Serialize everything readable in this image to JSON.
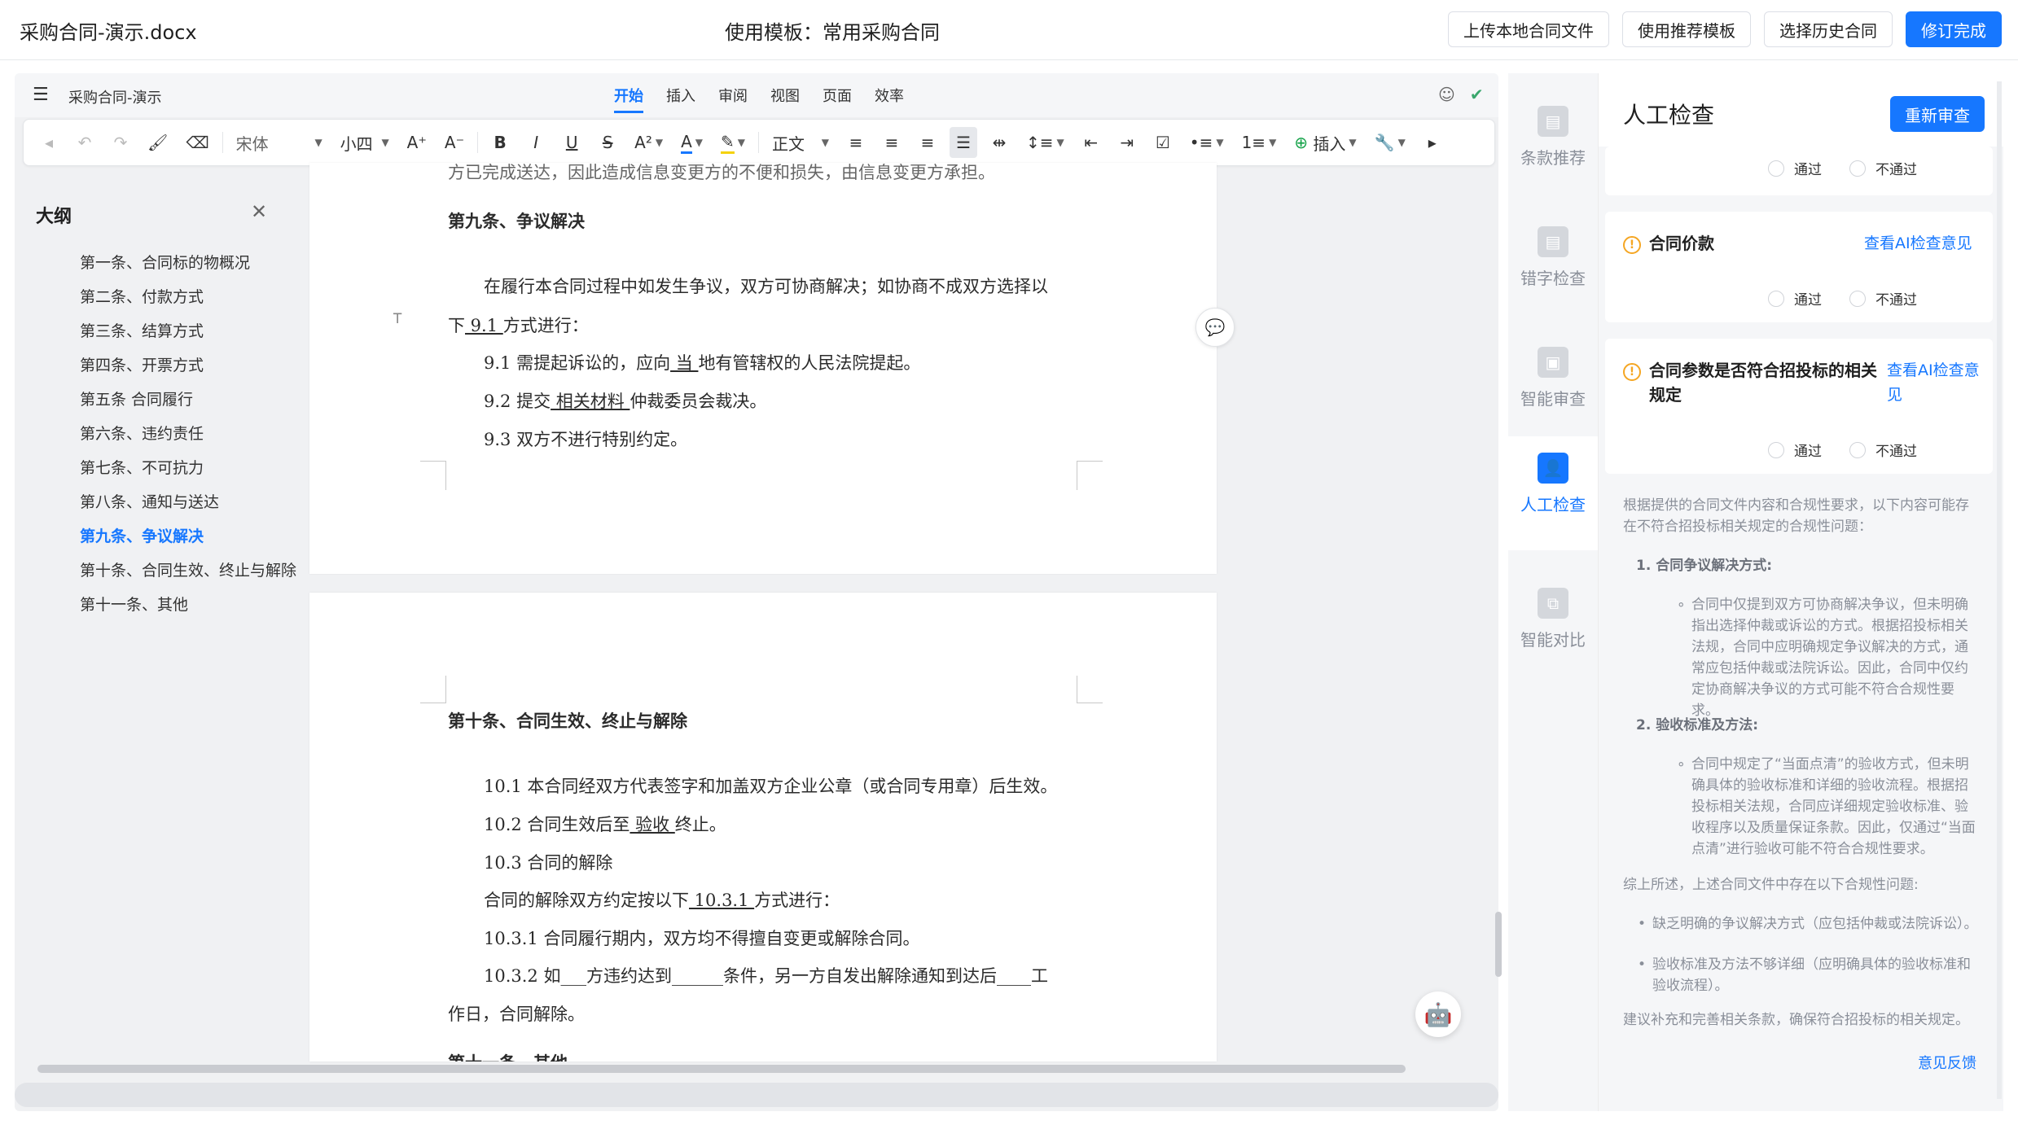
{
  "topbar": {
    "doc_title": "采购合同-演示.docx",
    "template": "使用模板：常用采购合同",
    "buttons": [
      "上传本地合同文件",
      "使用推荐模板",
      "选择历史合同",
      "修订完成"
    ]
  },
  "editor": {
    "doc_name": "采购合同-演示",
    "tabs": [
      "开始",
      "插入",
      "审阅",
      "视图",
      "页面",
      "效率"
    ],
    "active_tab": "开始",
    "toolbar": {
      "font": "宋体",
      "size": "小四",
      "para_style": "正文",
      "insert_label": "插入"
    }
  },
  "outline": {
    "title": "大纲",
    "items": [
      "第一条、合同标的物概况",
      "第二条、付款方式",
      "第三条、结算方式",
      "第四条、开票方式",
      "第五条 合同履行",
      "第六条、违约责任",
      "第七条、不可抗力",
      "第八条、通知与送达",
      "第九条、争议解决",
      "第十条、合同生效、终止与解除",
      "第十一条、其他"
    ],
    "active_index": 8
  },
  "page1": {
    "top_fragment": "方已完成送达，因此造成信息变更方的不便和损失，由信息变更方承担。",
    "heading": "第九条、争议解决",
    "p1a": "在履行本合同过程中如发生争议，双方可协商解决；如协商不成双方选择以",
    "p1b_pre": "下",
    "p1b_fill": " 9.1 ",
    "p1b_post": "方式进行：",
    "l1_pre": "9.1 需提起诉讼的，应向",
    "l1_fill": " 当 ",
    "l1_post": "地有管辖权的人民法院提起。",
    "l2_pre": "9.2 提交",
    "l2_fill": " 相关材料 ",
    "l2_post": "仲裁委员会裁决。",
    "l3": "9.3 双方不进行特别约定。"
  },
  "page2": {
    "heading": "第十条、合同生效、终止与解除",
    "l1": "10.1 本合同经双方代表签字和加盖双方企业公章（或合同专用章）后生效。",
    "l2_pre": "10.2 合同生效后至",
    "l2_fill": " 验收 ",
    "l2_post": "终止。",
    "l3": "10.3 合同的解除",
    "l4_pre": "合同的解除双方约定按以下",
    "l4_fill": " 10.3.1 ",
    "l4_post": "方式进行：",
    "l5": "10.3.1 合同履行期内，双方均不得擅自变更或解除合同。",
    "l6": "10.3.2 如___方违约达到______条件，另一方自发出解除通知到达后____工",
    "l7": "作日，合同解除。",
    "bottom_fragment": "第十一条、其他"
  },
  "tools": {
    "items": [
      "条款推荐",
      "错字检查",
      "智能审查",
      "人工检查",
      "智能对比"
    ],
    "active": "人工检查"
  },
  "review": {
    "title": "人工检查",
    "recheck": "重新审查",
    "pass": "通过",
    "fail": "不通过",
    "cards": [
      {
        "title": "合同价款",
        "link": "查看AI检查意见"
      },
      {
        "title": "合同参数是否符合招投标的相关规定",
        "link": "查看AI检查意见"
      }
    ],
    "ai": {
      "intro": "根据提供的合同文件内容和合规性要求，以下内容可能存在不符合招投标相关规定的合规性问题：",
      "h1": "1. 合同争议解决方式:",
      "b1": "合同中仅提到双方可协商解决争议，但未明确指出选择仲裁或诉讼的方式。根据招投标相关法规，合同中应明确规定争议解决的方式，通常应包括仲裁或法院诉讼。因此，合同中仅约定协商解决争议的方式可能不符合合规性要求。",
      "h2": "2. 验收标准及方法:",
      "b2": "合同中规定了“当面点清”的验收方式，但未明确具体的验收标准和详细的验收流程。根据招投标相关法规，合同应详细规定验收标准、验收程序以及质量保证条款。因此，仅通过“当面点清”进行验收可能不符合合规性要求。",
      "summary": "综上所述，上述合同文件中存在以下合规性问题:",
      "s1": "缺乏明确的争议解决方式（应包括仲裁或法院诉讼）。",
      "s2": "验收标准及方法不够详细（应明确具体的验收标准和验收流程）。",
      "advice": "建议补充和完善相关条款，确保符合招投标的相关规定。"
    },
    "feedback": "意见反馈"
  },
  "colors": {
    "accent": "#1677ff",
    "warning": "#f5a623"
  }
}
